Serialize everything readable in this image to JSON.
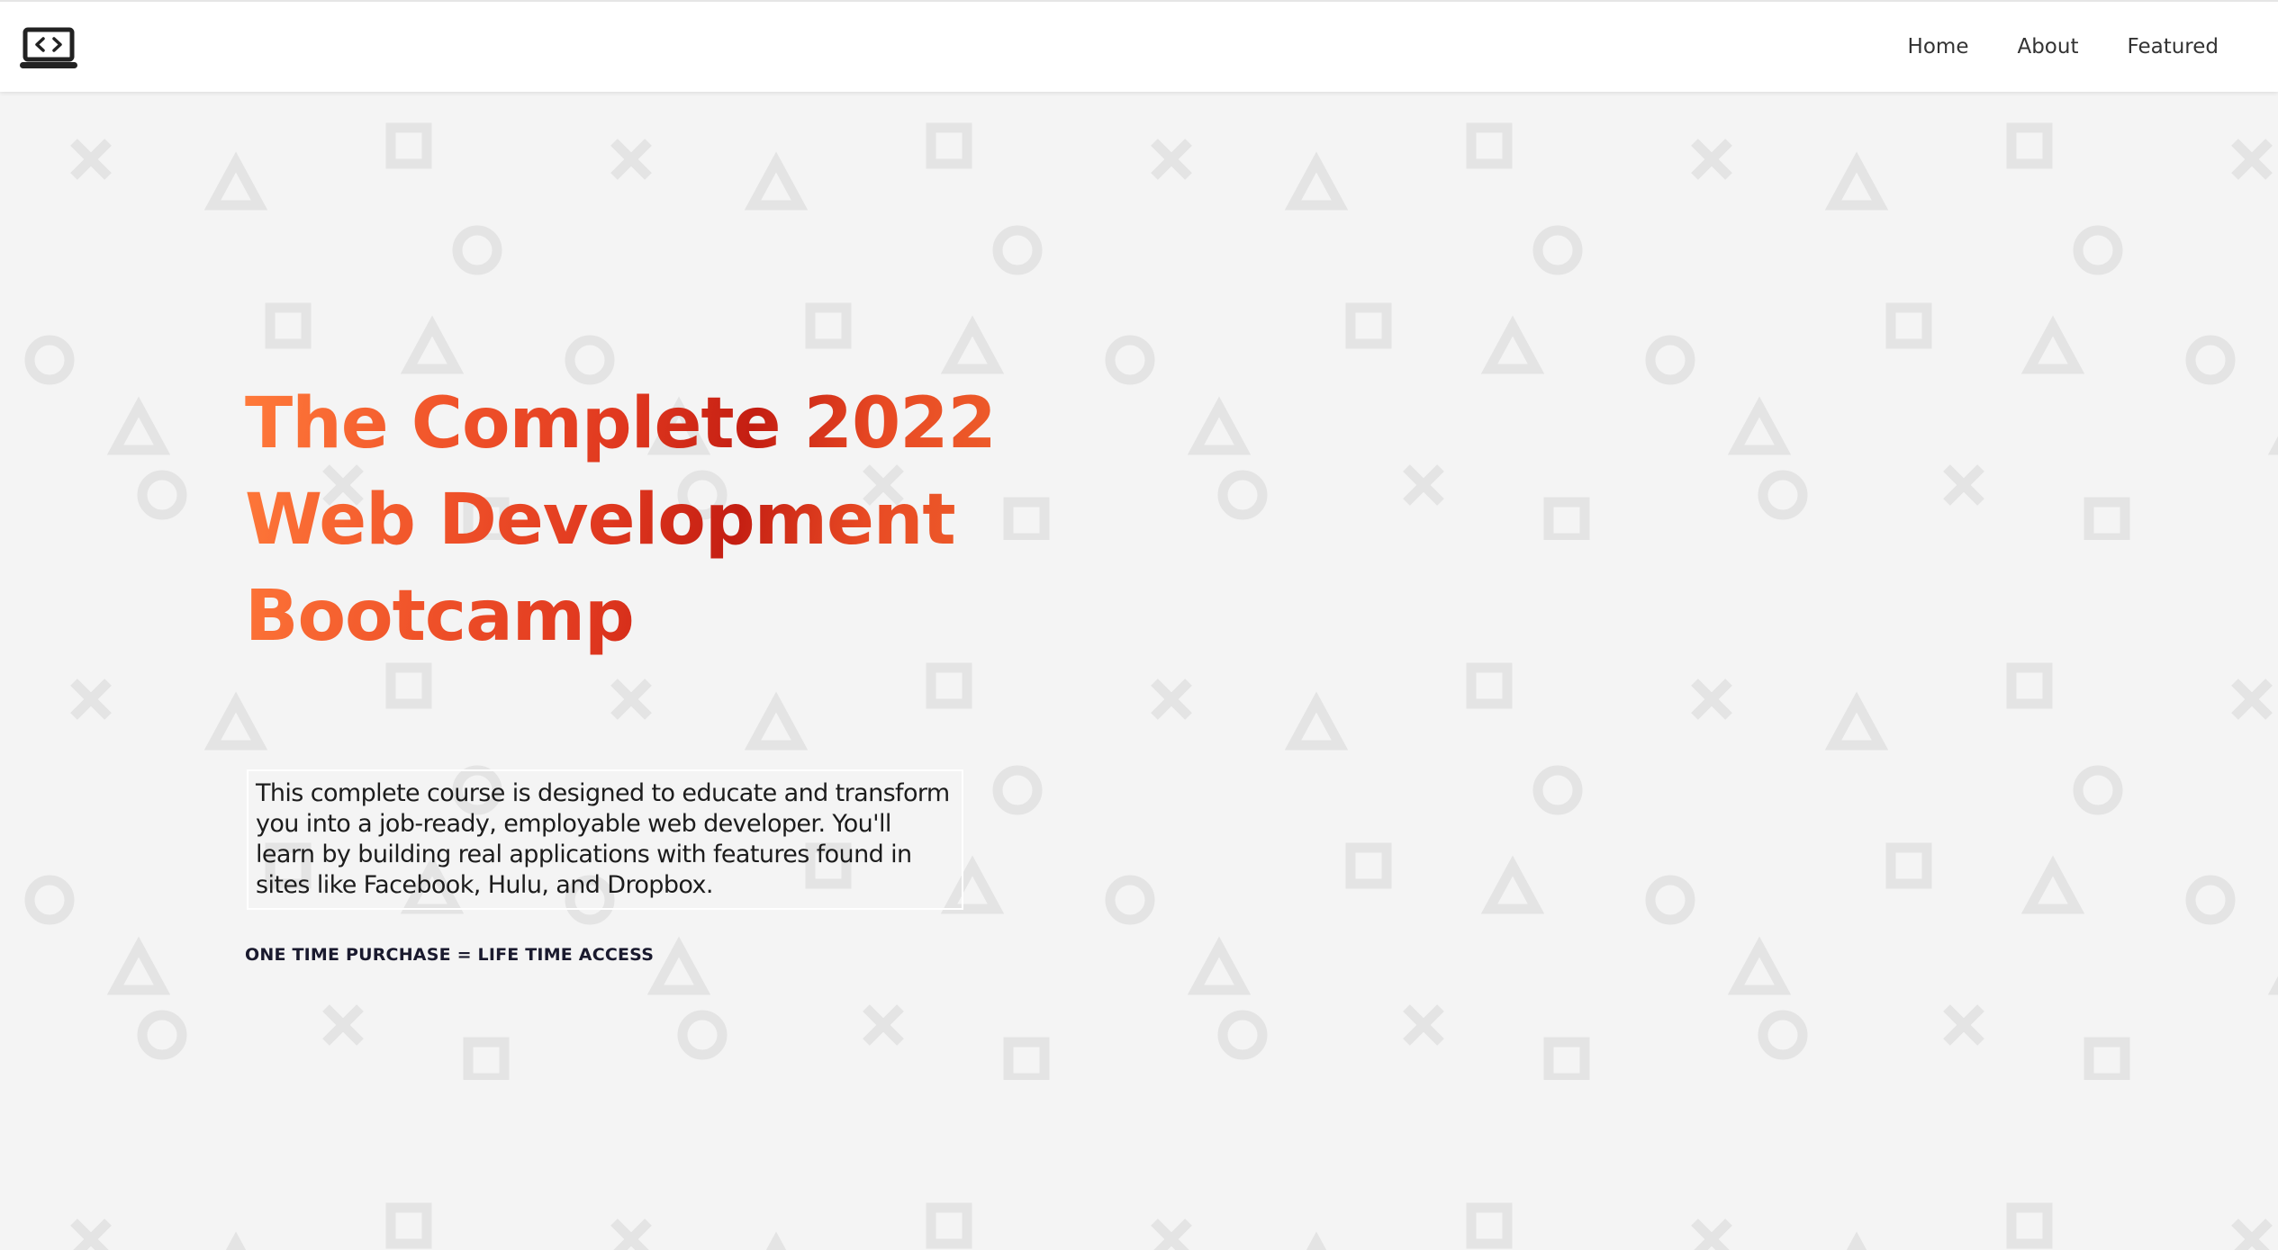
{
  "header": {
    "logo_icon": "laptop-code-icon",
    "nav": [
      {
        "label": "Home"
      },
      {
        "label": "About"
      },
      {
        "label": "Featured"
      }
    ]
  },
  "hero": {
    "title_lines": [
      "The Complete 2022",
      "Web Development",
      "Bootcamp"
    ],
    "description": "This complete course is designed to educate and transform you into a job-ready, employable web developer. You'll learn by building real applications with features found in sites like Facebook, Hulu, and Dropbox.",
    "tagline": "ONE TIME PURCHASE = LIFE TIME ACCESS"
  },
  "theme": {
    "background": "#f4f4f4",
    "pattern_color": "#e6e6e6",
    "title_gradient": [
      "#ff7a3a",
      "#e0381f",
      "#c41e12",
      "#f26a2f"
    ],
    "text_color": "#1c1c1c"
  },
  "background_pattern": {
    "shapes": [
      "cross",
      "square",
      "triangle",
      "circle"
    ]
  }
}
